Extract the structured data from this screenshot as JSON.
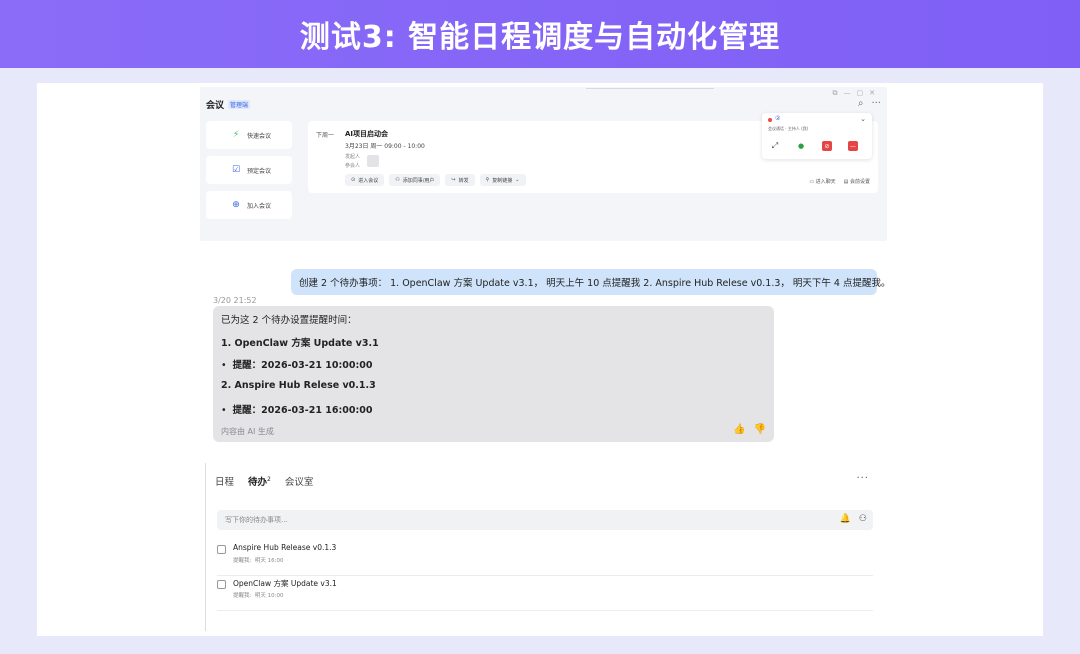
{
  "banner": {
    "title": "测试3: 智能日程调度与自动化管理"
  },
  "meeting_app": {
    "title": "会议",
    "badge": "管理端",
    "sidebar": [
      {
        "label": "快速会议",
        "icon": "lightning-icon",
        "color": "#3db35a"
      },
      {
        "label": "预定会议",
        "icon": "calendar-check-icon",
        "color": "#3a66e0"
      },
      {
        "label": "加入会议",
        "icon": "plus-circle-icon",
        "color": "#3a66e0"
      }
    ],
    "next_card": {
      "next_label": "下周一",
      "meeting_name": "AI项目启动会",
      "meeting_time": "3月23日 周一 09:00 - 10:00",
      "host_label": "发起人",
      "participants_label": "参会人",
      "actions": [
        {
          "label": "进入会议",
          "icon": "enter-icon"
        },
        {
          "label": "添加同事/用户",
          "icon": "add-user-icon"
        },
        {
          "label": "转发",
          "icon": "share-icon"
        },
        {
          "label": "复制链接",
          "icon": "link-icon"
        }
      ],
      "right_actions": [
        "进入聊天",
        "会前设置"
      ]
    },
    "call_panel": {
      "title_glyph": "②",
      "status": "会议通话 · 主持人 (我)",
      "buttons": [
        {
          "name": "expand-icon",
          "glyph": "⤢",
          "color": "#444"
        },
        {
          "name": "mic-icon",
          "glyph": "🎙",
          "color": "#2ea043"
        },
        {
          "name": "camera-off-icon",
          "glyph": "■",
          "color": "#e54545"
        },
        {
          "name": "hangup-icon",
          "glyph": "▬",
          "color": "#e54545"
        }
      ]
    }
  },
  "chat": {
    "user_message": "创建 2 个待办事项： 1. OpenClaw 方案 Update v3.1， 明天上午 10 点提醒我  2. Anspire Hub Relese v0.1.3， 明天下午 4 点提醒我。",
    "timestamp": "3/20 21:52",
    "ai_intro": "已为这 2 个待办设置提醒时间：",
    "ai_items": [
      {
        "index": "1.",
        "title": "OpenClaw 方案 Update v3.1",
        "reminder_label": "提醒：",
        "reminder": "2026-03-21 10:00:00"
      },
      {
        "index": "2.",
        "title": "Anspire Hub Relese v0.1.3",
        "reminder_label": "提醒：",
        "reminder": "2026-03-21 16:00:00"
      }
    ],
    "ai_footer": "内容由 AI 生成"
  },
  "todo_panel": {
    "tabs": [
      {
        "label": "日程"
      },
      {
        "label": "待办",
        "count": "2"
      },
      {
        "label": "会议室"
      }
    ],
    "input_placeholder": "写下你的待办事项...",
    "items": [
      {
        "title": "Anspire Hub Release v0.1.3",
        "reminder_label": "提醒我:",
        "reminder": "明天 16:00"
      },
      {
        "title": "OpenClaw 方案 Update v3.1",
        "reminder_label": "提醒我:",
        "reminder": "明天 10:00"
      }
    ]
  }
}
